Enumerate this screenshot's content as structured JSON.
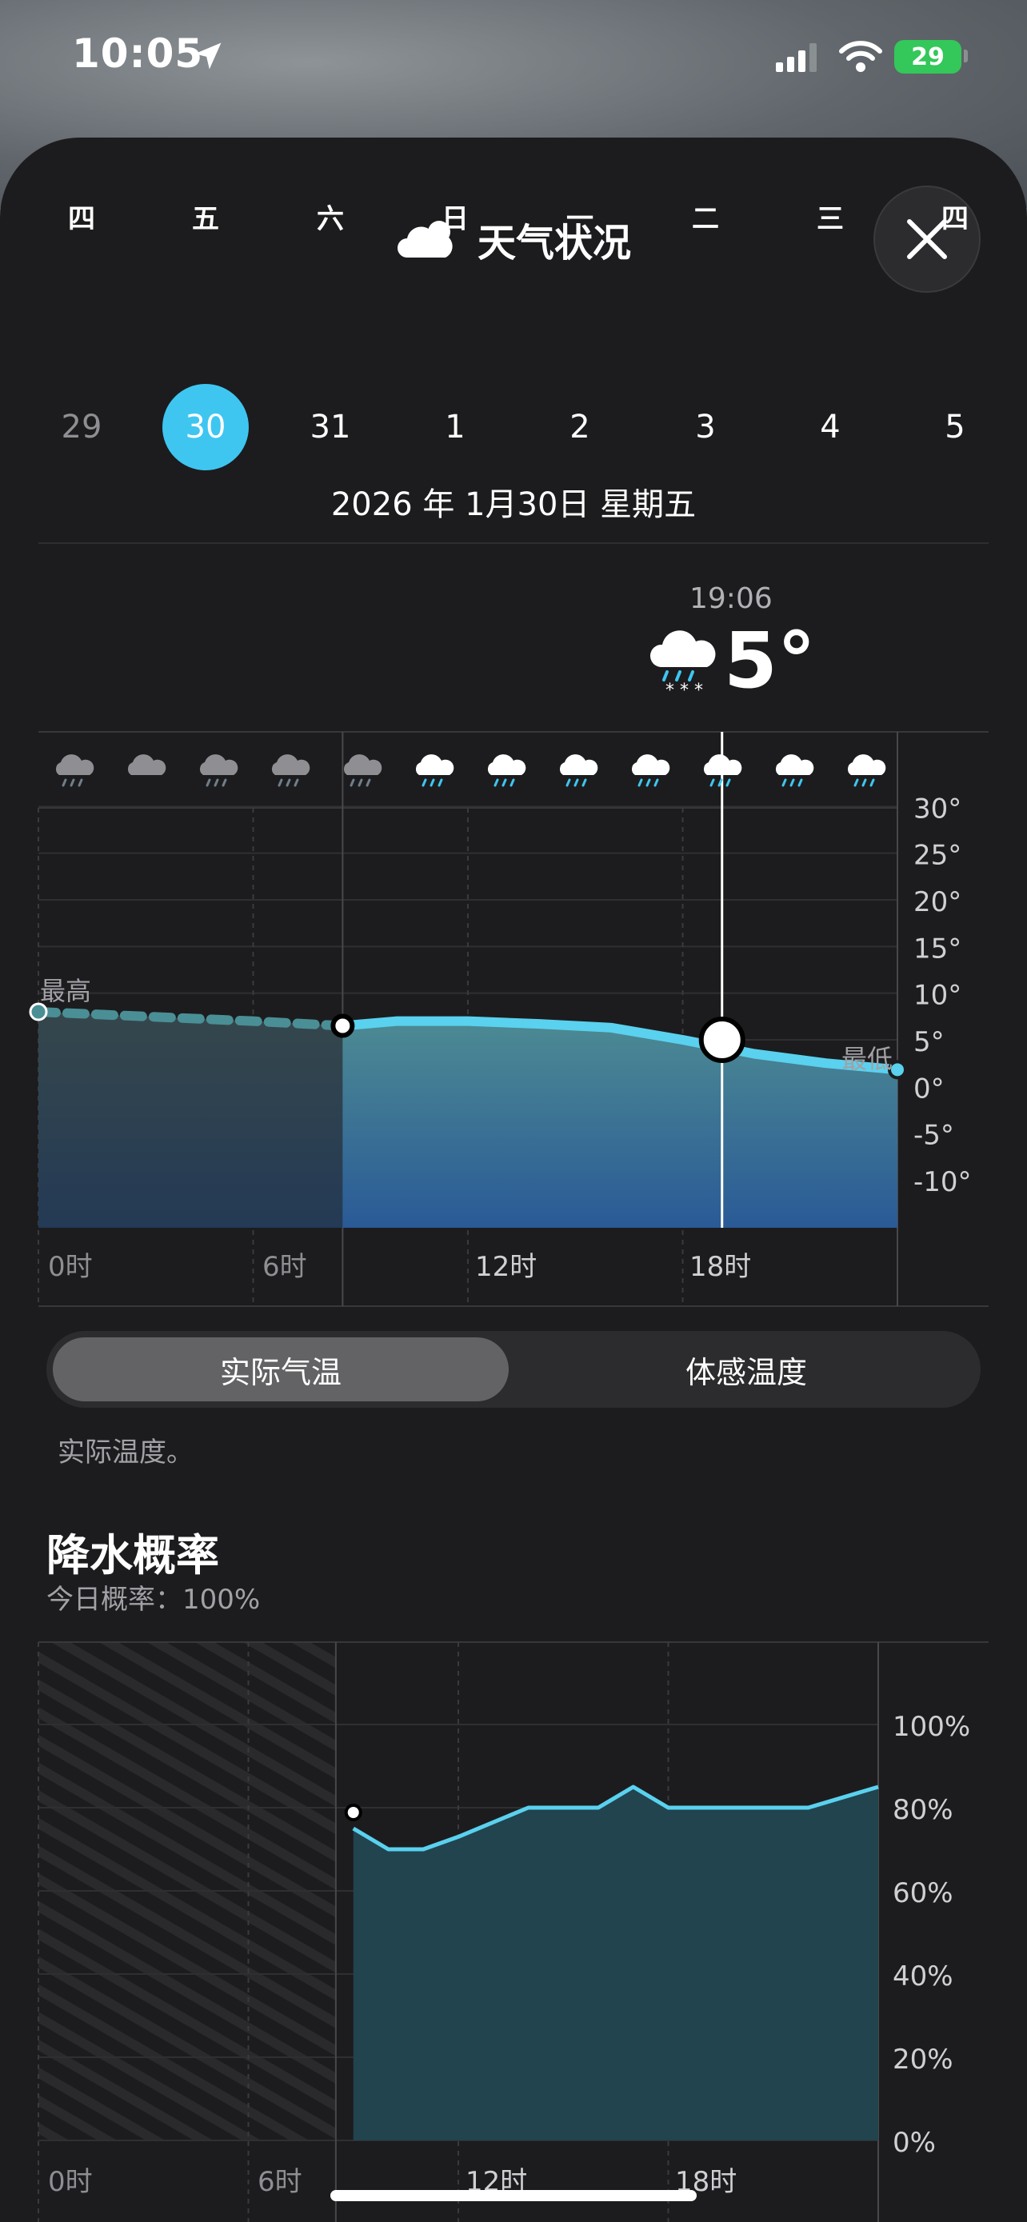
{
  "status_bar": {
    "time": "10:05",
    "battery": "29"
  },
  "sheet": {
    "title": "天气状况"
  },
  "calendar": {
    "weekdays": [
      "四",
      "五",
      "六",
      "日",
      "一",
      "二",
      "三",
      "四"
    ],
    "days": [
      "29",
      "30",
      "31",
      "1",
      "2",
      "3",
      "4",
      "5"
    ],
    "selected_index": 1,
    "full_date": "2026 年 1月30日 星期五"
  },
  "current": {
    "time": "19:06",
    "temp": "5°"
  },
  "temp_chart": {
    "label_high": "最高",
    "label_low": "最低",
    "y_ticks": [
      "30°",
      "25°",
      "20°",
      "15°",
      "10°",
      "5°",
      "0°",
      "-5°",
      "-10°"
    ],
    "x_ticks": [
      "0时",
      "6时",
      "12时",
      "18时"
    ]
  },
  "toggle": {
    "actual": "实际气温",
    "feels": "体感温度"
  },
  "description": "实际温度。",
  "precip": {
    "title": "降水概率",
    "subtitle": "今日概率：100%",
    "y_ticks": [
      "100%",
      "80%",
      "60%",
      "40%",
      "20%",
      "0%"
    ],
    "x_ticks": [
      "0时",
      "6时",
      "12时",
      "18时"
    ]
  },
  "colors": {
    "accent": "#3ec6f1",
    "sheet_bg": "#1c1c1e",
    "battery": "#34c759"
  },
  "chart_data": [
    {
      "type": "area",
      "x_unit": "hour",
      "series": [
        {
          "x": [
            0,
            3,
            6,
            8.5,
            10,
            12,
            14,
            16,
            18,
            20,
            22,
            24
          ],
          "values": [
            8,
            7.5,
            7,
            6.5,
            7,
            7,
            6.7,
            6.3,
            5,
            3.5,
            2.5,
            1.8
          ]
        }
      ],
      "ylim": [
        -10,
        35
      ],
      "current_point": {
        "x": 19.1,
        "y": 5
      }
    },
    {
      "type": "area",
      "x_unit": "hour",
      "series": [
        {
          "x": [
            9,
            10,
            11,
            12,
            14,
            16,
            17,
            18,
            20,
            22,
            24
          ],
          "values": [
            75,
            70,
            70,
            73,
            80,
            80,
            85,
            80,
            80,
            80,
            85
          ]
        }
      ],
      "ylim": [
        0,
        110
      ]
    }
  ]
}
